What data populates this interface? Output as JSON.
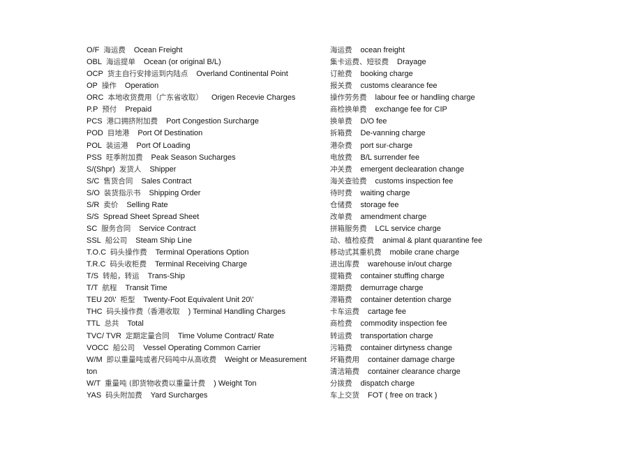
{
  "left_column": [
    {
      "code": "O/F",
      "cn": "海运费",
      "en": "Ocean Freight"
    },
    {
      "code": "OBL",
      "cn": "海运提单",
      "en": "Ocean (or original B/L)"
    },
    {
      "code": "OCP",
      "cn": "货主自行安排运到内陆点",
      "en": "Overland Continental Point"
    },
    {
      "code": "OP",
      "cn": "操作",
      "en": "Operation"
    },
    {
      "code": "ORC",
      "cn": "本地收货费用（广东省收取）",
      "en": "Origen Recevie Charges"
    },
    {
      "code": "P.P",
      "cn": "预付",
      "en": "Prepaid"
    },
    {
      "code": "PCS",
      "cn": "港口拥挤附加费",
      "en": "Port Congestion Surcharge"
    },
    {
      "code": "POD",
      "cn": "目地港",
      "en": "Port Of Destination"
    },
    {
      "code": "POL",
      "cn": "装运港",
      "en": "Port Of Loading"
    },
    {
      "code": "PSS",
      "cn": "旺季附加费",
      "en": "Peak Season Sucharges"
    },
    {
      "code": "S/(Shpr)",
      "cn": "发货人",
      "en": "Shipper"
    },
    {
      "code": "S/C",
      "cn": "售货合同",
      "en": "Sales Contract"
    },
    {
      "code": "S/O",
      "cn": "装货指示书",
      "en": "Shipping Order"
    },
    {
      "code": "S/R",
      "cn": "卖价",
      "en": "Selling Rate"
    },
    {
      "code": "S/S",
      "cn": "",
      "en": "Spread Sheet Spread Sheet"
    },
    {
      "code": "SC",
      "cn": "服务合同",
      "en": "Service Contract"
    },
    {
      "code": "SSL",
      "cn": "船公司",
      "en": "Steam Ship Line"
    },
    {
      "code": "T.O.C",
      "cn": "码头操作费",
      "en": "Terminal Operations Option"
    },
    {
      "code": "T.R.C",
      "cn": "码头收柜费",
      "en": "Terminal Receiving Charge"
    },
    {
      "code": "T/S",
      "cn": "转船，转运",
      "en": "Trans-Ship"
    },
    {
      "code": "T/T",
      "cn": "航程",
      "en": "Transit Time"
    },
    {
      "code": "TEU 20\\'",
      "cn": "柜型",
      "en": "Twenty-Foot Equivalent Unit 20\\'"
    },
    {
      "code": "THC",
      "cn": "码头操作费（香港收取",
      "en": ") Terminal Handling Charges"
    },
    {
      "code": "TTL",
      "cn": "总共",
      "en": "Total"
    },
    {
      "code": "TVC/ TVR",
      "cn": "定期定量合同",
      "en": "Time Volume Contract/ Rate"
    },
    {
      "code": "VOCC",
      "cn": "船公司",
      "en": "Vessel Operating Common Carrier"
    },
    {
      "code": "W/M",
      "cn": "即以重量吨或者尺码吨中从高收费",
      "en": "Weight   or   Measurement"
    },
    {
      "code": "",
      "cn": "",
      "en": "ton"
    },
    {
      "code": "W/T",
      "cn": "重量吨 (即货物收费以重量计费",
      "en": ") Weight Ton"
    },
    {
      "code": "YAS",
      "cn": "码头附加费",
      "en": "Yard Surcharges"
    }
  ],
  "right_column": [
    {
      "cn": "海运费",
      "en": "ocean freight"
    },
    {
      "cn": "集卡运费、短驳费",
      "en": "Drayage"
    },
    {
      "cn": "订舱费",
      "en": "booking charge"
    },
    {
      "cn": "报关费",
      "en": "customs clearance fee"
    },
    {
      "cn": "操作劳务费",
      "en": "labour fee or handling charge"
    },
    {
      "cn": "商检换单费",
      "en": "exchange fee for CIP"
    },
    {
      "cn": "换单费",
      "en": "D/O fee"
    },
    {
      "cn": "拆箱费",
      "en": "De-vanning charge"
    },
    {
      "cn": "港杂费",
      "en": "port sur-charge"
    },
    {
      "cn": "电放费",
      "en": "B/L surrender fee"
    },
    {
      "cn": "冲关费",
      "en": "emergent declearation change"
    },
    {
      "cn": "海关查验费",
      "en": "customs inspection fee"
    },
    {
      "cn": "待时费",
      "en": "waiting charge"
    },
    {
      "cn": "仓储费",
      "en": "storage fee"
    },
    {
      "cn": "改单费",
      "en": "amendment charge"
    },
    {
      "cn": "拼箱服务费",
      "en": "LCL service charge"
    },
    {
      "cn": "动、植检疫费",
      "en": "animal & plant quarantine fee"
    },
    {
      "cn": "移动式其重机费",
      "en": "mobile crane charge"
    },
    {
      "cn": "进出库费",
      "en": "warehouse in/out charge"
    },
    {
      "cn": "提箱费",
      "en": "container stuffing charge"
    },
    {
      "cn": "滞期费",
      "en": "demurrage charge"
    },
    {
      "cn": "滞箱费",
      "en": "container detention charge"
    },
    {
      "cn": "卡车运费",
      "en": "cartage fee"
    },
    {
      "cn": "商检费",
      "en": "commodity inspection fee"
    },
    {
      "cn": "转运费",
      "en": "transportation charge"
    },
    {
      "cn": "污箱费",
      "en": "container dirtyness change"
    },
    {
      "cn": "坏箱费用",
      "en": "container damage charge"
    },
    {
      "cn": "清洁箱费",
      "en": "container clearance charge"
    },
    {
      "cn": "分拨费",
      "en": "dispatch charge"
    },
    {
      "cn": "车上交货",
      "en": "FOT ( free on track )"
    }
  ]
}
